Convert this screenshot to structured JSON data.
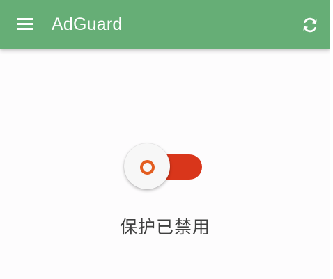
{
  "toolbar": {
    "title": "AdGuard",
    "menu_icon": "menu-icon",
    "refresh_icon": "refresh-icon",
    "background_color": "#66ae76"
  },
  "protection": {
    "status_text": "保护已禁用",
    "toggle_state": "off",
    "toggle_track_color": "#d9361b",
    "toggle_ring_color": "#e35d20"
  }
}
